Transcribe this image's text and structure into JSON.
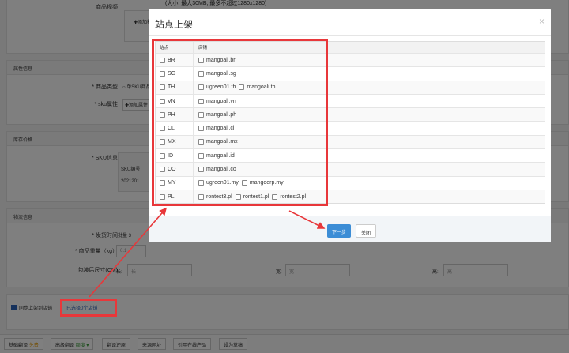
{
  "background": {
    "video_label": "商品视频",
    "video_hint": "(大小: 最大30MB, 最多不超过1280x1280)",
    "add_video": "✚添加视频",
    "attr_section": "属性信息",
    "product_type_label": "* 商品类型",
    "product_type_value": "单SKU商品",
    "sku_attr_label": "* sku属性",
    "add_attr": "✚添加属性",
    "stock_section": "库存价格",
    "sku_info_label": "* SKU信息",
    "sku_code_label": "SKU编号",
    "sku_code_value": "2021201",
    "logistics_section": "物流信息",
    "ship_time_label": "* 发货时间",
    "ship_time_value": "批量 3",
    "weight_label": "* 商品重量（kg）",
    "weight_value": "0.1",
    "size_label": "包装后尺寸(CM)",
    "length_label": "长:",
    "length_ph": "长",
    "width_label": "宽:",
    "width_ph": "宽",
    "height_label": "高:",
    "height_ph": "高",
    "sync_label": "同步上架到店铺",
    "selected_shops": "已选择0个店铺"
  },
  "bottom_bar": [
    {
      "label": "基础翻译",
      "tag": "免费"
    },
    {
      "label": "高级翻译",
      "tag": "额度 ▾"
    },
    {
      "label": "翻译还原"
    },
    {
      "label": "来源网址"
    },
    {
      "label": "引用在线产品"
    },
    {
      "label": "设为草稿"
    }
  ],
  "modal": {
    "title": "站点上架",
    "close": "×",
    "headers": [
      "站点",
      "店铺"
    ],
    "rows": [
      {
        "site": "BR",
        "shops": [
          "mangoali.br"
        ]
      },
      {
        "site": "SG",
        "shops": [
          "mangoali.sg"
        ]
      },
      {
        "site": "TH",
        "shops": [
          "ugreen01.th",
          "mangoali.th"
        ]
      },
      {
        "site": "VN",
        "shops": [
          "mangoali.vn"
        ]
      },
      {
        "site": "PH",
        "shops": [
          "mangoali.ph"
        ]
      },
      {
        "site": "CL",
        "shops": [
          "mangoali.cl"
        ]
      },
      {
        "site": "MX",
        "shops": [
          "mangoali.mx"
        ]
      },
      {
        "site": "ID",
        "shops": [
          "mangoali.id"
        ]
      },
      {
        "site": "CO",
        "shops": [
          "mangoali.co"
        ]
      },
      {
        "site": "MY",
        "shops": [
          "ugreen01.my",
          "mangoerp.my"
        ]
      },
      {
        "site": "PL",
        "shops": [
          "rontest3.pl",
          "rontest1.pl",
          "rontest2.pl"
        ]
      }
    ],
    "next_button": "下一步",
    "close_button": "关闭"
  },
  "colors": {
    "primary": "#3c8dd6",
    "annotation": "#e8373a"
  }
}
